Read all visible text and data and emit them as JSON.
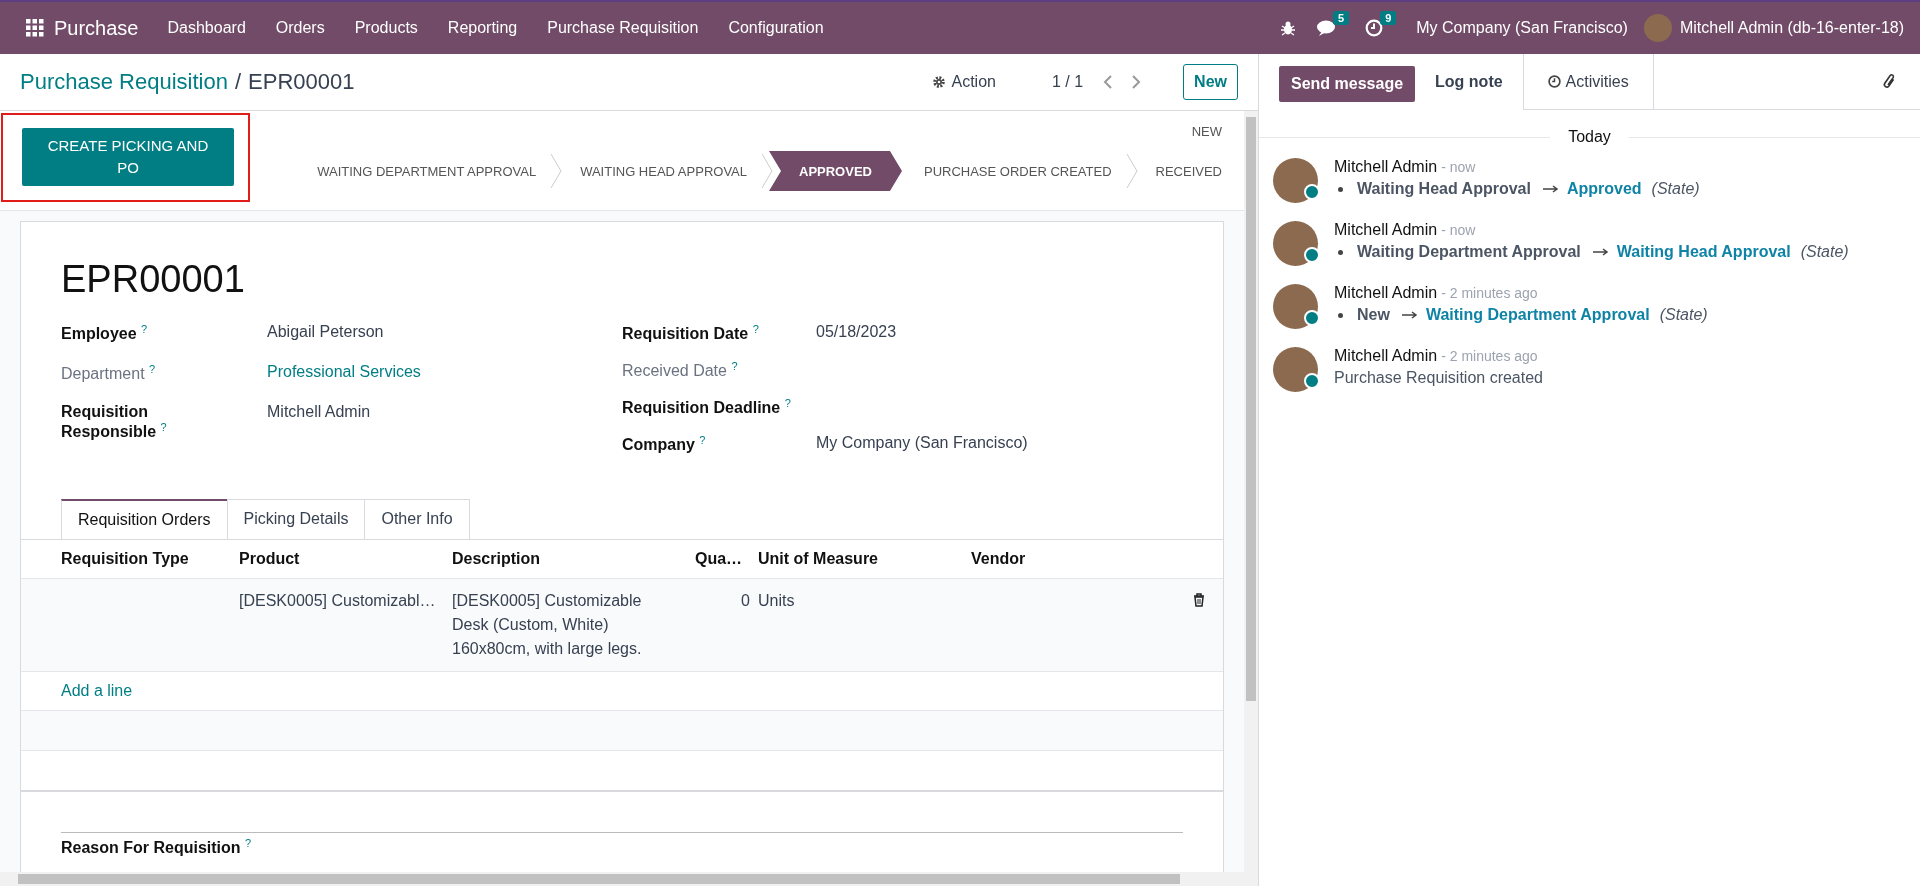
{
  "navbar": {
    "app_name": "Purchase",
    "menu": [
      "Dashboard",
      "Orders",
      "Products",
      "Reporting",
      "Purchase Requisition",
      "Configuration"
    ],
    "chat_badge": "5",
    "activity_badge": "9",
    "company": "My Company (San Francisco)",
    "user": "Mitchell Admin (db-16-enter-18)"
  },
  "control_panel": {
    "breadcrumb_parent": "Purchase Requisition",
    "breadcrumb_separator": "/",
    "breadcrumb_current": "EPR00001",
    "action": "Action",
    "pager": "1 / 1",
    "new_button": "New"
  },
  "header": {
    "button": "CREATE PICKING AND PO",
    "highlighted": true,
    "stages": [
      {
        "label": "NEW",
        "selected": false
      },
      {
        "label": "WAITING DEPARTMENT APPROVAL",
        "selected": false
      },
      {
        "label": "WAITING HEAD APPROVAL",
        "selected": false
      },
      {
        "label": "APPROVED",
        "selected": true
      },
      {
        "label": "PURCHASE ORDER CREATED",
        "selected": false
      },
      {
        "label": "RECEIVED",
        "selected": false
      }
    ]
  },
  "sheet": {
    "title": "EPR00001",
    "left_fields": [
      {
        "label": "Employee $^{?}$",
        "required": true,
        "value": "Abigail Peterson",
        "link": false
      },
      {
        "label": "Department $^{?}$",
        "required": false,
        "value": "Professional Services",
        "link": true
      },
      {
        "label": "Requisition Responsible $^{?}$",
        "required": true,
        "value": "Mitchell Admin",
        "link": false
      }
    ],
    "right_fields": [
      {
        "label": "Requisition Date $^{?}$",
        "required": true,
        "value": "05/18/2023",
        "link": false
      },
      {
        "label": "Received Date $^{?}$",
        "required": false
      },
      {
        "label": "Requisition Deadline $^{?}$",
        "required": true
      },
      {
        "label": "Company $^{?}$",
        "required": true,
        "value": "My Company (San Francisco)",
        "link": false
      }
    ],
    "tabs": [
      {
        "label": "Requisition Orders",
        "selected": true
      },
      {
        "label": "Picking Details",
        "selected": false
      },
      {
        "label": "Other Info",
        "selected": false
      }
    ],
    "table": {
      "columns": [
        "Requisition Type",
        "Product",
        "Description",
        "Qua…",
        "Unit of Measure",
        "Vendor"
      ],
      "rows": [
        {
          "product": "[DESK0005] Customizabl…",
          "description": "[DESK0005] Customizable Desk (Custom, White) 160x80cm, with large legs.",
          "quantity": "0",
          "unit": "Units"
        }
      ]
    },
    "add_line": "Add a line",
    "reason_label": "Reason For Requisition $^{?}$"
  },
  "chatter": {
    "send_message": "Send message",
    "log_note": "Log note",
    "activities": "Activities",
    "date_divider": "Today",
    "messages": [
      {
        "author": "Mitchell Admin",
        "time": "- now",
        "online": true,
        "kind": "tracking",
        "old": "Waiting Head Approval",
        "new": "Approved",
        "field": "(State)"
      },
      {
        "author": "Mitchell Admin",
        "time": "- now",
        "online": true,
        "kind": "tracking",
        "old": "Waiting Department Approval",
        "new": "Waiting Head Approval",
        "field": "(State)"
      },
      {
        "author": "Mitchell Admin",
        "time": "- 2 minutes ago",
        "online": true,
        "kind": "tracking",
        "old": "New",
        "new": "Waiting Department Approval",
        "field": "(State)"
      },
      {
        "author": "Mitchell Admin",
        "time": "- 2 minutes ago",
        "online": true,
        "kind": "text",
        "body": "Purchase Requisition created"
      }
    ]
  }
}
